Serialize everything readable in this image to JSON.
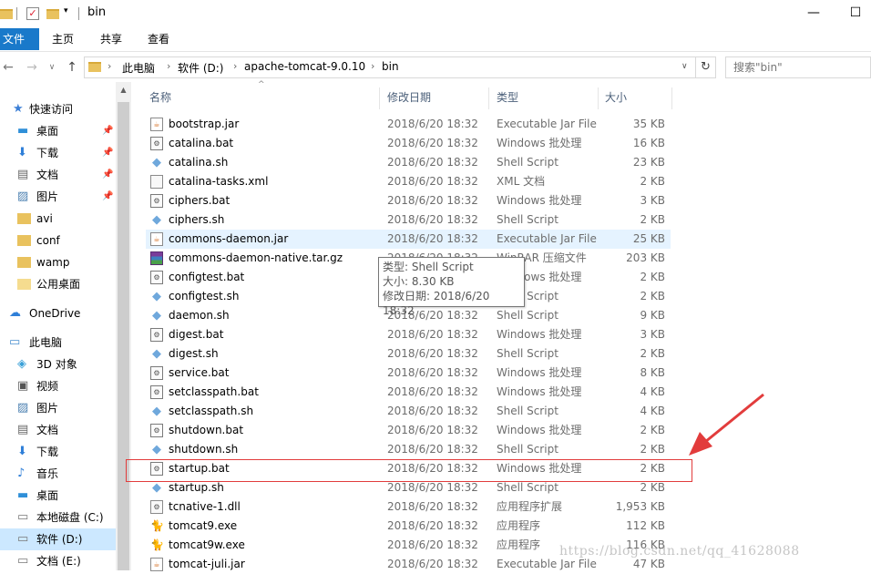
{
  "window": {
    "title": "bin",
    "minimize": "—",
    "maximize": "☐"
  },
  "ribbon": {
    "tabs": [
      "文件",
      "主页",
      "共享",
      "查看"
    ]
  },
  "address": {
    "crumbs": [
      "此电脑",
      "软件 (D:)",
      "apache-tomcat-9.0.10",
      "bin"
    ],
    "search_placeholder": "搜索\"bin\""
  },
  "sidebar": {
    "items": [
      {
        "label": "快速访问",
        "icon": "star-icon",
        "pinned": false
      },
      {
        "label": "桌面",
        "icon": "desktop-icon",
        "pinned": true
      },
      {
        "label": "下载",
        "icon": "download-icon",
        "pinned": true
      },
      {
        "label": "文档",
        "icon": "document-icon",
        "pinned": true
      },
      {
        "label": "图片",
        "icon": "picture-icon",
        "pinned": true
      },
      {
        "label": "avi",
        "icon": "folder-icon",
        "pinned": false
      },
      {
        "label": "conf",
        "icon": "folder-icon",
        "pinned": false
      },
      {
        "label": "wamp",
        "icon": "folder-icon",
        "pinned": false
      },
      {
        "label": "公用桌面",
        "icon": "folder-icon",
        "pinned": false
      },
      {
        "label": "OneDrive",
        "icon": "onedrive-icon",
        "pinned": false
      },
      {
        "label": "此电脑",
        "icon": "computer-icon",
        "pinned": false
      },
      {
        "label": "3D 对象",
        "icon": "3d-objects-icon",
        "pinned": false
      },
      {
        "label": "视频",
        "icon": "video-icon",
        "pinned": false
      },
      {
        "label": "图片",
        "icon": "picture-icon",
        "pinned": false
      },
      {
        "label": "文档",
        "icon": "document-icon",
        "pinned": false
      },
      {
        "label": "下载",
        "icon": "download-icon",
        "pinned": false
      },
      {
        "label": "音乐",
        "icon": "music-icon",
        "pinned": false
      },
      {
        "label": "桌面",
        "icon": "desktop-icon",
        "pinned": false
      },
      {
        "label": "本地磁盘 (C:)",
        "icon": "drive-icon",
        "pinned": false
      },
      {
        "label": "软件 (D:)",
        "icon": "drive-icon",
        "pinned": false
      },
      {
        "label": "文档 (E:)",
        "icon": "drive-icon",
        "pinned": false
      }
    ]
  },
  "columns": {
    "name": "名称",
    "date": "修改日期",
    "type": "类型",
    "size": "大小"
  },
  "files": [
    {
      "name": "bootstrap.jar",
      "date": "2018/6/20 18:32",
      "type": "Executable Jar File",
      "size": "35 KB",
      "icon": "jar"
    },
    {
      "name": "catalina.bat",
      "date": "2018/6/20 18:32",
      "type": "Windows 批处理",
      "size": "16 KB",
      "icon": "bat"
    },
    {
      "name": "catalina.sh",
      "date": "2018/6/20 18:32",
      "type": "Shell Script",
      "size": "23 KB",
      "icon": "sh"
    },
    {
      "name": "catalina-tasks.xml",
      "date": "2018/6/20 18:32",
      "type": "XML 文档",
      "size": "2 KB",
      "icon": "xml"
    },
    {
      "name": "ciphers.bat",
      "date": "2018/6/20 18:32",
      "type": "Windows 批处理",
      "size": "3 KB",
      "icon": "bat"
    },
    {
      "name": "ciphers.sh",
      "date": "2018/6/20 18:32",
      "type": "Shell Script",
      "size": "2 KB",
      "icon": "sh"
    },
    {
      "name": "commons-daemon.jar",
      "date": "2018/6/20 18:32",
      "type": "Executable Jar File",
      "size": "25 KB",
      "icon": "jar"
    },
    {
      "name": "commons-daemon-native.tar.gz",
      "date": "2018/6/20 18:32",
      "type": "WinRAR 压缩文件",
      "size": "203 KB",
      "icon": "rar"
    },
    {
      "name": "configtest.bat",
      "date": "2018/6/20 18:32",
      "type": "Windows 批处理",
      "size": "2 KB",
      "icon": "bat"
    },
    {
      "name": "configtest.sh",
      "date": "2018/6/20 18:32",
      "type": "Shell Script",
      "size": "2 KB",
      "icon": "sh"
    },
    {
      "name": "daemon.sh",
      "date": "2018/6/20 18:32",
      "type": "Shell Script",
      "size": "9 KB",
      "icon": "sh"
    },
    {
      "name": "digest.bat",
      "date": "2018/6/20 18:32",
      "type": "Windows 批处理",
      "size": "3 KB",
      "icon": "bat"
    },
    {
      "name": "digest.sh",
      "date": "2018/6/20 18:32",
      "type": "Shell Script",
      "size": "2 KB",
      "icon": "sh"
    },
    {
      "name": "service.bat",
      "date": "2018/6/20 18:32",
      "type": "Windows 批处理",
      "size": "8 KB",
      "icon": "bat"
    },
    {
      "name": "setclasspath.bat",
      "date": "2018/6/20 18:32",
      "type": "Windows 批处理",
      "size": "4 KB",
      "icon": "bat"
    },
    {
      "name": "setclasspath.sh",
      "date": "2018/6/20 18:32",
      "type": "Shell Script",
      "size": "4 KB",
      "icon": "sh"
    },
    {
      "name": "shutdown.bat",
      "date": "2018/6/20 18:32",
      "type": "Windows 批处理",
      "size": "2 KB",
      "icon": "bat"
    },
    {
      "name": "shutdown.sh",
      "date": "2018/6/20 18:32",
      "type": "Shell Script",
      "size": "2 KB",
      "icon": "sh"
    },
    {
      "name": "startup.bat",
      "date": "2018/6/20 18:32",
      "type": "Windows 批处理",
      "size": "2 KB",
      "icon": "bat"
    },
    {
      "name": "startup.sh",
      "date": "2018/6/20 18:32",
      "type": "Shell Script",
      "size": "2 KB",
      "icon": "sh"
    },
    {
      "name": "tcnative-1.dll",
      "date": "2018/6/20 18:32",
      "type": "应用程序扩展",
      "size": "1,953 KB",
      "icon": "dll"
    },
    {
      "name": "tomcat9.exe",
      "date": "2018/6/20 18:32",
      "type": "应用程序",
      "size": "112 KB",
      "icon": "exe"
    },
    {
      "name": "tomcat9w.exe",
      "date": "2018/6/20 18:32",
      "type": "应用程序",
      "size": "116 KB",
      "icon": "exe"
    },
    {
      "name": "tomcat-juli.jar",
      "date": "2018/6/20 18:32",
      "type": "Executable Jar File",
      "size": "47 KB",
      "icon": "jar"
    }
  ],
  "tooltip": {
    "line1": "类型: Shell Script",
    "line2": "大小: 8.30 KB",
    "line3": "修改日期: 2018/6/20 18:32"
  },
  "watermark": "https://blog.csdn.net/qq_41628088",
  "colors": {
    "accent": "#1979ca",
    "highlight_box": "#e23c3c",
    "arrow": "#e23c3c",
    "hover_row": "#e5f3ff"
  }
}
